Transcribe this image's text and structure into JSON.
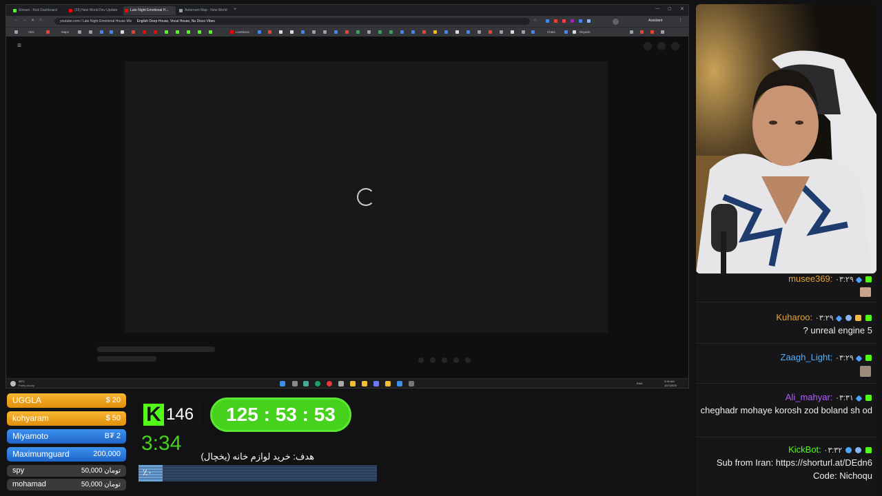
{
  "browser": {
    "tabs": [
      {
        "title": "Stream - Kick Dashboard",
        "color": "#53fc18"
      },
      {
        "title": "(25) New World Dev Update",
        "color": "#ff0000"
      },
      {
        "title": "Late Night Emotional H...",
        "color": "#ff0000",
        "active": true
      },
      {
        "title": "Aeternum Map - New World",
        "color": "#9aa0a6"
      }
    ],
    "url": "youtube.com / Late Night Emotional House Mix",
    "url_extra": "English Deep House, Vocal House, Nu Disco Vibes",
    "bookmarks": [
      "ADs",
      "Maps",
      "LiveMusic",
      "Chats",
      "Reyarin"
    ],
    "right_bookmark": "Assistant",
    "weather": "28°C",
    "weather_desc": "Partly cloudy",
    "tray_lang": "ENG",
    "tray_time": "3:34 AM",
    "tray_date": "10/7/2025"
  },
  "chat": {
    "messages": [
      {
        "time": "۰۳:۲۹",
        "user": "musee369",
        "user_color": "#e8a23a",
        "text": "",
        "emote": true
      },
      {
        "time": "۰۳:۲۹",
        "user": "Kuharoo",
        "user_color": "#e8a23a",
        "text": "? unreal engine 5",
        "emote": false
      },
      {
        "time": "۰۳:۲۹",
        "user": "Zaagh_Light",
        "user_color": "#4fb0ff",
        "text": "",
        "emote": true
      },
      {
        "time": "۰۳:۳۱",
        "user": "Ali_mahyar",
        "user_color": "#b35cff",
        "text": "cheghadr mohaye korosh zod boland sh od",
        "emote": false
      },
      {
        "time": "۰۳:۳۲",
        "user": "KickBot",
        "user_color": "#53fc18",
        "text": "Sub from Iran: https://shorturl.at/DEdn6 Code: Nichoqu",
        "emote": false
      }
    ]
  },
  "donations": [
    {
      "name": "UGGLA",
      "amount": "$ 20",
      "color": "#f0a21b"
    },
    {
      "name": "kohyaram",
      "amount": "$ 50",
      "color": "#f0a21b"
    },
    {
      "name": "Miyamoto",
      "amount": "B₮ 2",
      "color": "#2f7fe0"
    },
    {
      "name": "Maximumguard",
      "amount": "200,000",
      "color": "#2f7fe0"
    },
    {
      "name": "spy",
      "amount": "50,000 تومان",
      "color": "#3a3a3a"
    },
    {
      "name": "mohamad",
      "amount": "50,000 تومان",
      "color": "#3a3a3a"
    }
  ],
  "kick": {
    "logo": "K",
    "count": "146"
  },
  "timer": "125 : 53 : 53",
  "clock": "3:34",
  "goal": {
    "label": "هدف: خرید لوازم خانه (یخچال)",
    "text": "٪۰",
    "fraction": 0.1
  },
  "colors": {
    "kick_green": "#53fc18",
    "timer_green": "#46d11d"
  }
}
